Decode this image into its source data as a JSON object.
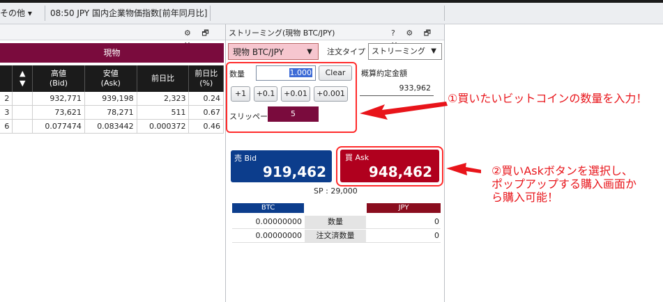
{
  "topbar": {
    "menu_label": "その他 ▾",
    "ticker_text": "08:50  JPY  国内企業物価指数[前年同月比]"
  },
  "rates_panel": {
    "window_icons": "⚙ 🗗 ✕",
    "section_label": "現物",
    "headers": [
      "",
      "▲\n▼",
      "高値\n(Bid)",
      "安値\n(Ask)",
      "前日比",
      "前日比\n(%)"
    ],
    "rows": [
      [
        "2",
        "",
        "932,771",
        "939,198",
        "2,323",
        "0.24"
      ],
      [
        "3",
        "",
        "73,621",
        "78,271",
        "511",
        "0.67"
      ],
      [
        "6",
        "",
        "0.077474",
        "0.083442",
        "0.000372",
        "0.46"
      ]
    ]
  },
  "order_panel": {
    "title": "ストリーミング(現物 BTC/JPY)",
    "window_icons": "? ⚙ 🗗 ✕",
    "pair_select": "現物 BTC/JPY",
    "order_type_label": "注文タイプ",
    "order_type_value": "ストリーミング",
    "qty_label": "数量",
    "qty_value": "1.000",
    "clear_label": "Clear",
    "increment_buttons": [
      "+1",
      "+0.1",
      "+0.01",
      "+0.001"
    ],
    "slippage_label": "スリッページ",
    "slippage_value": "5",
    "estimate_label": "概算約定金額",
    "estimate_value": "933,962",
    "bid_label": "売 Bid",
    "bid_price": "919,462",
    "ask_label": "買 Ask",
    "ask_price": "948,462",
    "spread": "SP : 29,000",
    "position": {
      "btc_label": "BTC",
      "jpy_label": "JPY",
      "rows": [
        {
          "btc": "0.00000000",
          "label": "数量",
          "jpy": "0"
        },
        {
          "btc": "0.00000000",
          "label": "注文済数量",
          "jpy": "0"
        }
      ]
    }
  },
  "annotations": {
    "note1": "①買いたいビットコインの数量を入力！",
    "note2_line1": "②買いAskボタンを選択し、",
    "note2_line2": "ポップアップする購入画面か",
    "note2_line3": "ら購入可能！",
    "color": "#e8141a"
  }
}
